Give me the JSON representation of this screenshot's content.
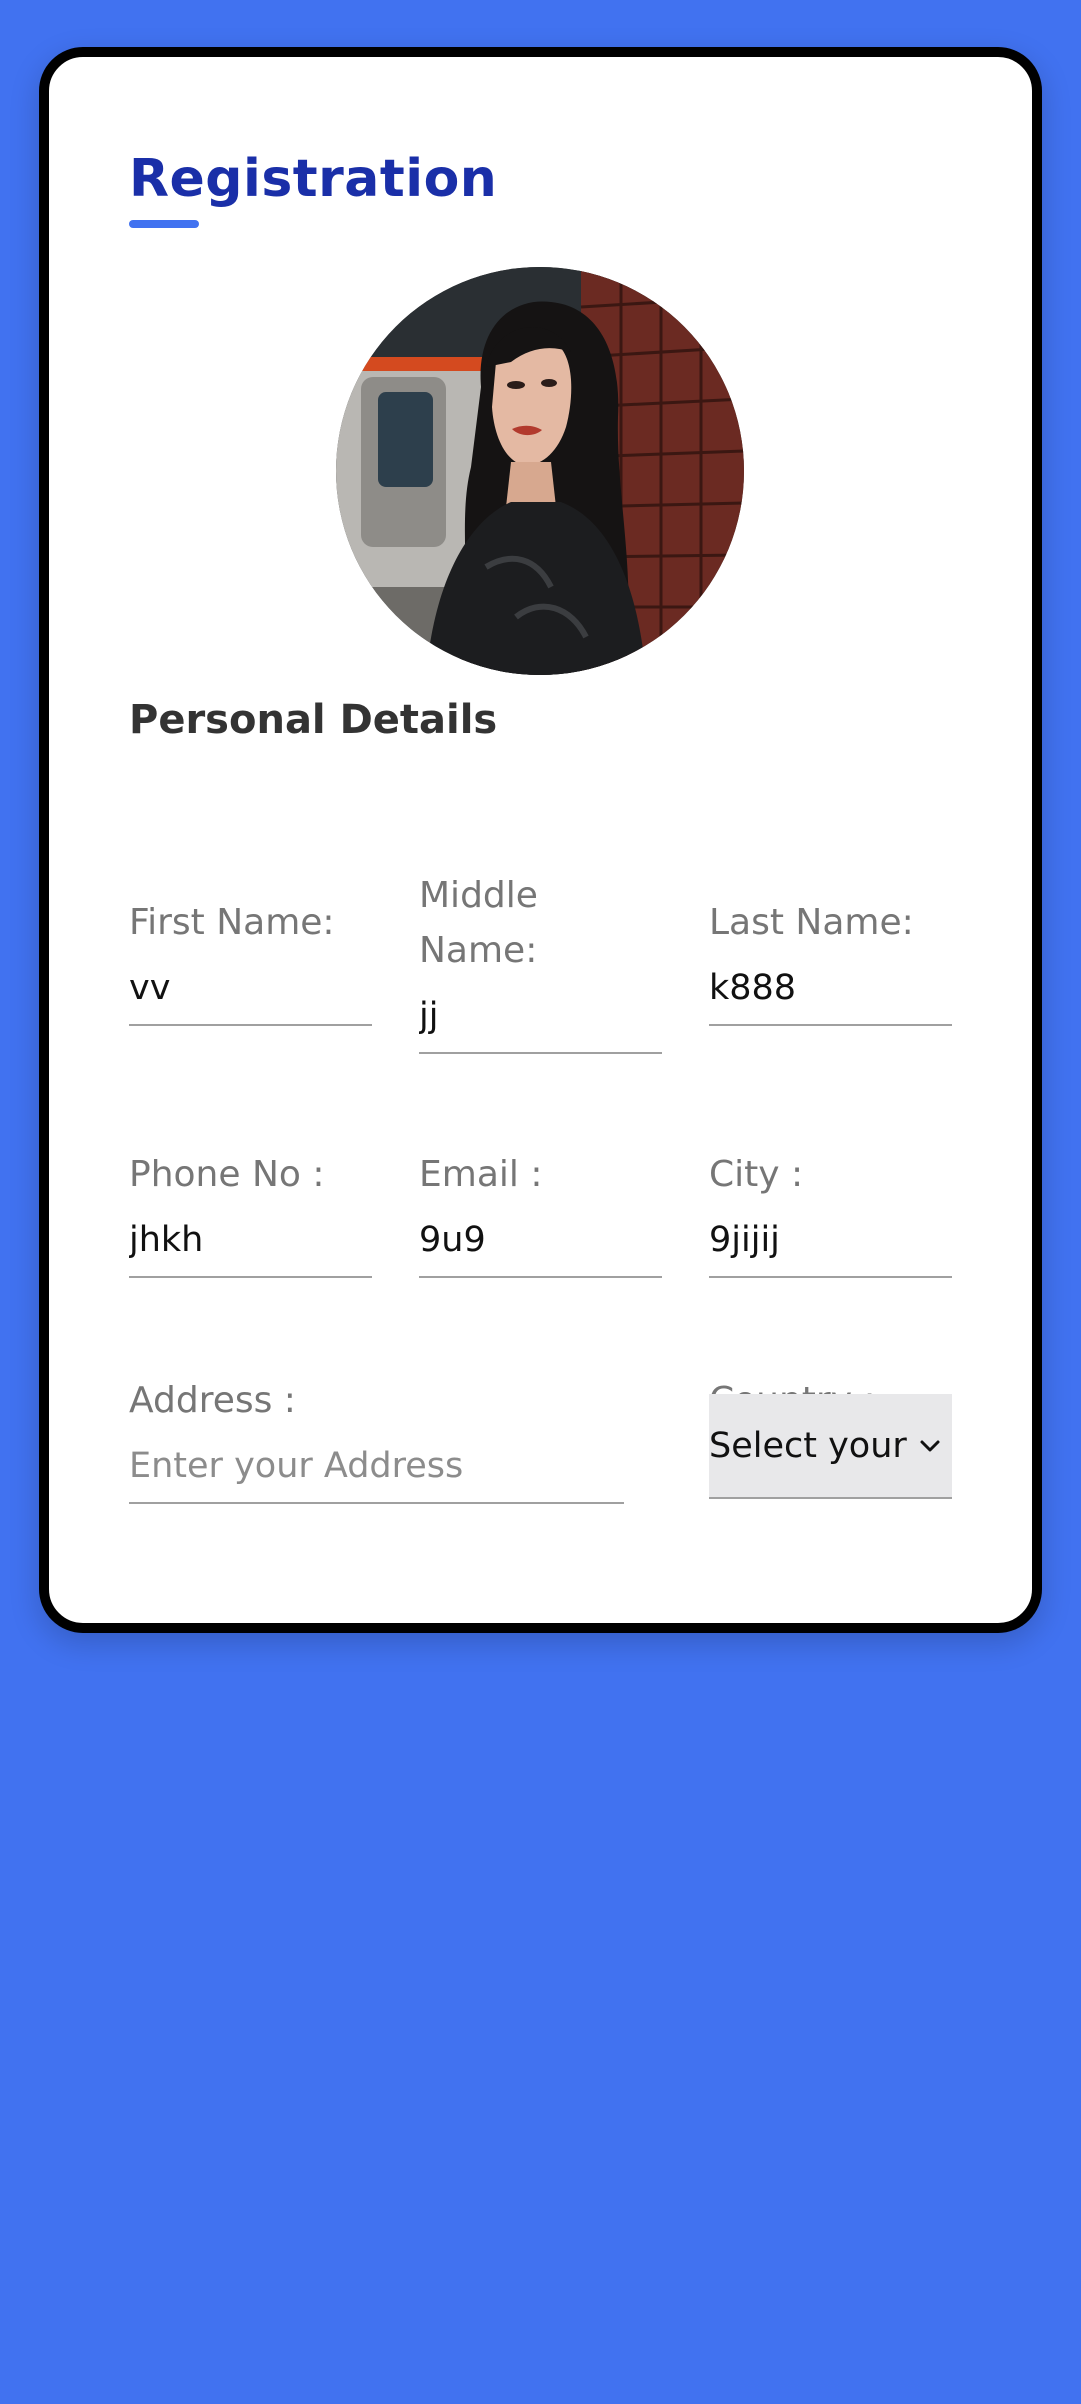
{
  "form": {
    "title": "Registration",
    "section_title": "Personal Details",
    "fields": {
      "first_name": {
        "label": "First Name:",
        "value": "vv"
      },
      "middle_name": {
        "label": "Middle Name:",
        "value": "jj"
      },
      "last_name": {
        "label": "Last Name:",
        "value": "k888"
      },
      "phone": {
        "label": "Phone No :",
        "value": "jhkh"
      },
      "email": {
        "label": "Email :",
        "value": "9u9"
      },
      "city": {
        "label": "City :",
        "value": "9jijij"
      },
      "address": {
        "label": "Address :",
        "placeholder": "Enter your Address",
        "value": ""
      },
      "country": {
        "label": "Country :",
        "selected": "Select your"
      }
    }
  },
  "icons": {
    "avatar": "profile-photo",
    "country_dropdown": "chevron-down-icon"
  },
  "colors": {
    "background": "#4172f0",
    "title": "#1a2fa8",
    "accent": "#4172f0",
    "card": "#ffffff",
    "card_border": "#000000"
  }
}
